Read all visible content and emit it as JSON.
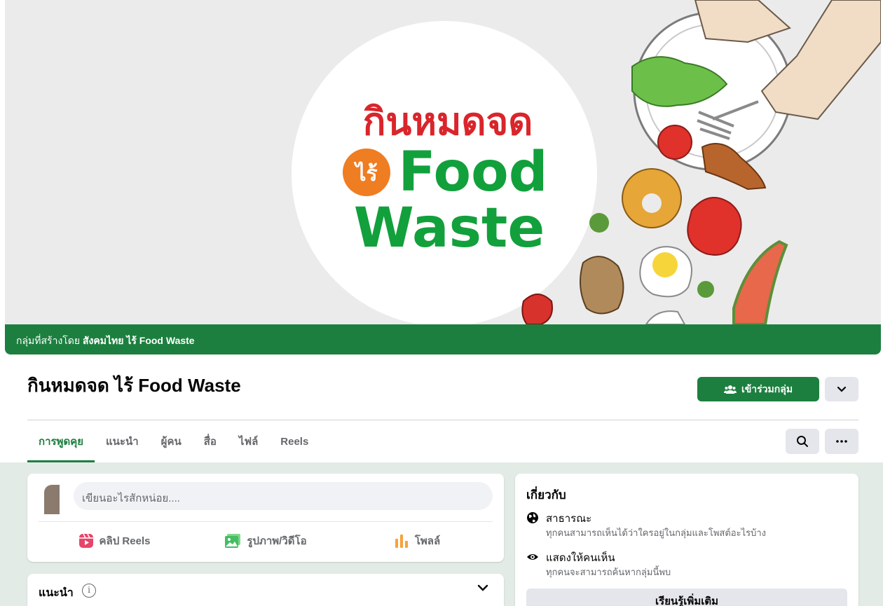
{
  "cover": {
    "logo_line1": "กินหมดจด",
    "logo_badge": "ไร้",
    "logo_line2": "Food",
    "logo_line3": "Waste"
  },
  "creator_bar": {
    "prefix": "กลุ่มที่สร้างโดย",
    "creator": "สังคมไทย ไร้ Food Waste"
  },
  "group": {
    "title": "กินหมดจด ไร้ Food Waste",
    "join_label": "เข้าร่วมกลุ่ม"
  },
  "tabs": [
    {
      "label": "การพูดคุย",
      "active": true
    },
    {
      "label": "แนะนำ",
      "active": false
    },
    {
      "label": "ผู้คน",
      "active": false
    },
    {
      "label": "สื่อ",
      "active": false
    },
    {
      "label": "ไฟล์",
      "active": false
    },
    {
      "label": "Reels",
      "active": false
    }
  ],
  "composer": {
    "placeholder": "เขียนอะไรสักหน่อย....",
    "actions": [
      {
        "label": "คลิป Reels",
        "icon": "reels-icon"
      },
      {
        "label": "รูปภาพ/วิดีโอ",
        "icon": "photo-icon"
      },
      {
        "label": "โพลล์",
        "icon": "poll-icon"
      }
    ]
  },
  "recommend": {
    "title": "แนะนำ"
  },
  "about": {
    "title": "เกี่ยวกับ",
    "rows": [
      {
        "icon": "globe-icon",
        "title": "สาธารณะ",
        "desc": "ทุกคนสามารถเห็นได้ว่าใครอยู่ในกลุ่มและโพสต์อะไรบ้าง"
      },
      {
        "icon": "eye-icon",
        "title": "แสดงให้คนเห็น",
        "desc": "ทุกคนจะสามารถค้นหากลุ่มนี้พบ"
      }
    ],
    "learn_more": "เรียนรู้เพิ่มเติม"
  },
  "colors": {
    "brand_green": "#1d7f3f",
    "logo_red": "#d9252b",
    "logo_green": "#12a03c",
    "badge_orange": "#ef7d22"
  }
}
